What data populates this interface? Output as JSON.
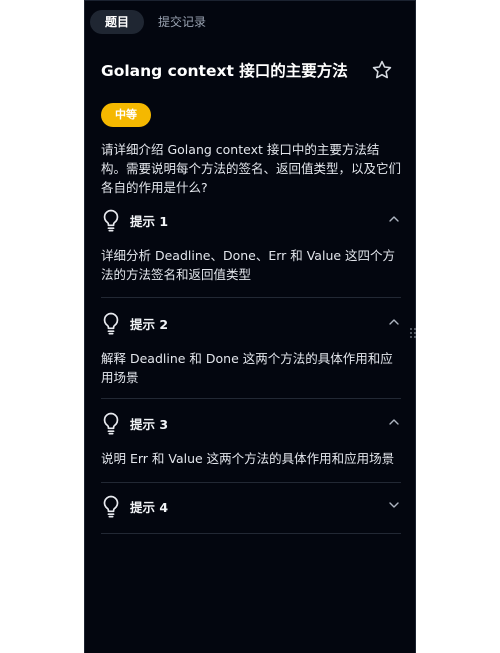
{
  "tabs": [
    {
      "label": "题目",
      "active": true
    },
    {
      "label": "提交记录",
      "active": false
    }
  ],
  "question": {
    "title": "Golang context 接口的主要方法",
    "difficulty": "中等",
    "description": "请详细介绍 Golang context 接口中的主要方法结构。需要说明每个方法的签名、返回值类型，以及它们各自的作用是什么?"
  },
  "hints": [
    {
      "title": "提示 1",
      "body": "详细分析 Deadline、Done、Err 和 Value 这四个方法的方法签名和返回值类型",
      "expanded": true
    },
    {
      "title": "提示 2",
      "body": "解释 Deadline 和 Done 这两个方法的具体作用和应用场景",
      "expanded": true
    },
    {
      "title": "提示 3",
      "body": "说明 Err 和 Value 这两个方法的具体作用和应用场景",
      "expanded": true
    },
    {
      "title": "提示 4",
      "body": "",
      "expanded": false
    }
  ],
  "colors": {
    "background": "#03060f",
    "badge": "#f5b800",
    "active_tab": "#1f2632"
  },
  "icons": {
    "favorite": "star-icon",
    "hint": "lightbulb-icon",
    "collapse": "chevron-up-icon",
    "expand": "chevron-down-icon"
  }
}
